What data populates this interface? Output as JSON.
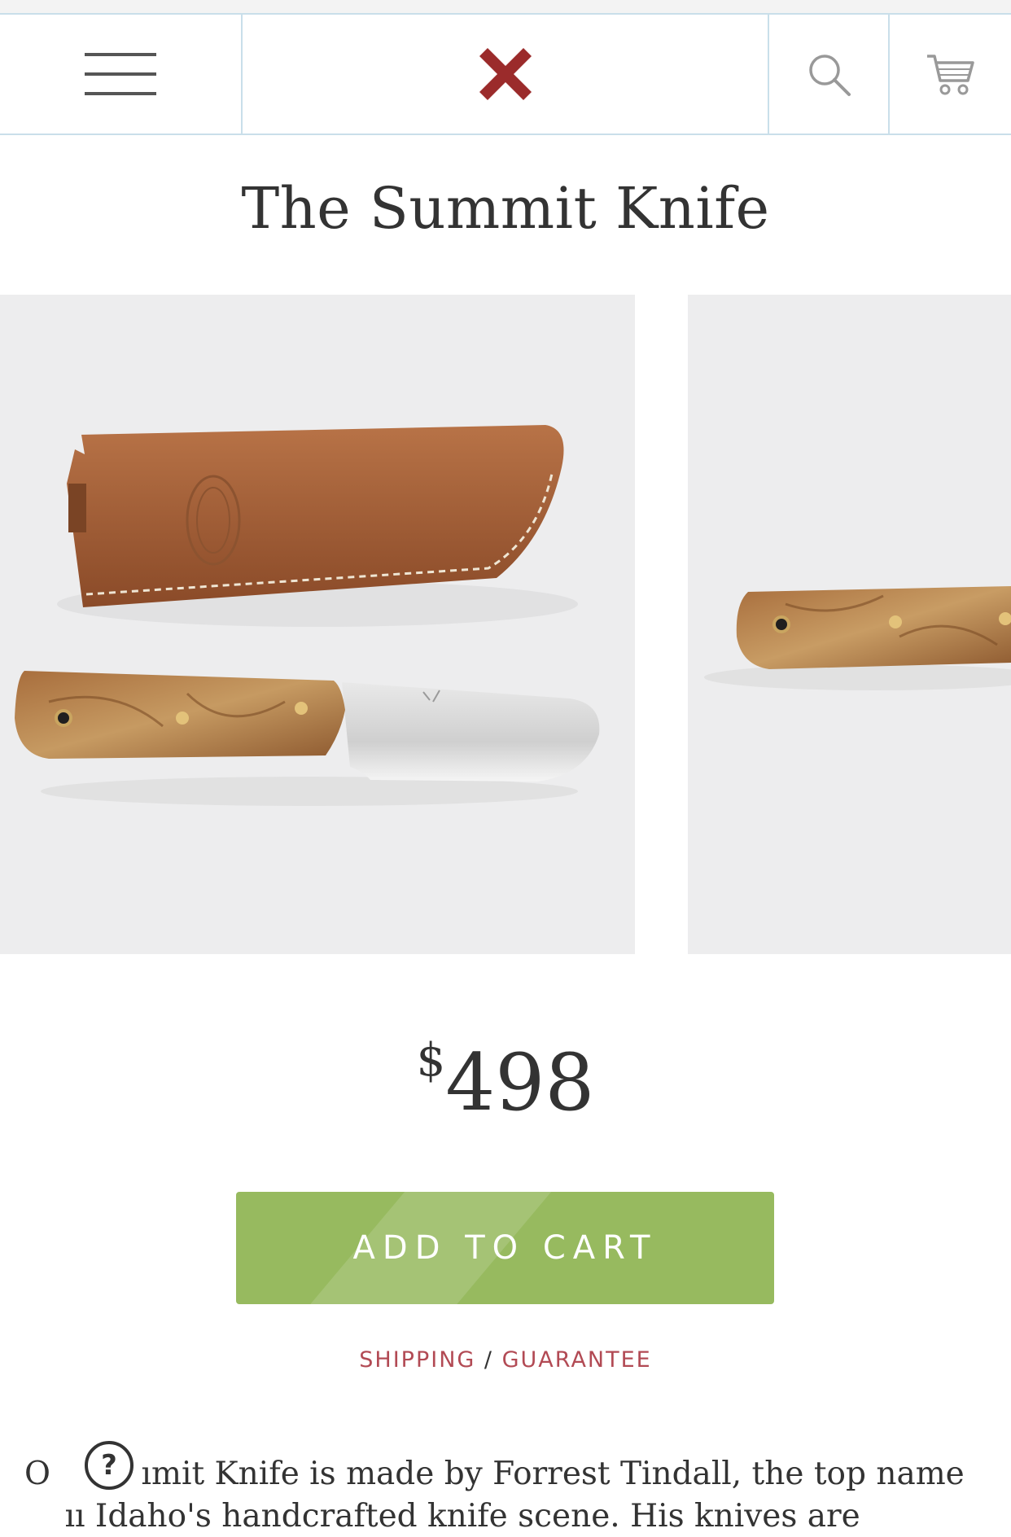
{
  "nav": {
    "menu_icon": "hamburger-menu-icon",
    "logo_icon": "x-logo-icon",
    "search_icon": "search-icon",
    "cart_icon": "cart-icon",
    "logo_color": "#9b2b2b",
    "rule_color": "#c9dfea"
  },
  "product": {
    "title": "The Summit Knife",
    "price_currency": "$",
    "price_amount": "498",
    "add_to_cart_label": "ADD TO CART",
    "button_color": "#97ba5f"
  },
  "policy_links": {
    "shipping": "SHIPPING",
    "separator": "/",
    "guarantee": "GUARANTEE",
    "link_color": "#b24a54"
  },
  "description": {
    "line1": "O         ımit Knife is made by Forrest Tindall, the top name",
    "line2": "    ıı Idaho's handcrafted knife scene. His knives are"
  },
  "help_icon": "question-help-icon",
  "help_glyph": "?",
  "images": {
    "primary": "knife-with-leather-sheath-image",
    "secondary": "knife-handle-closeup-image"
  }
}
